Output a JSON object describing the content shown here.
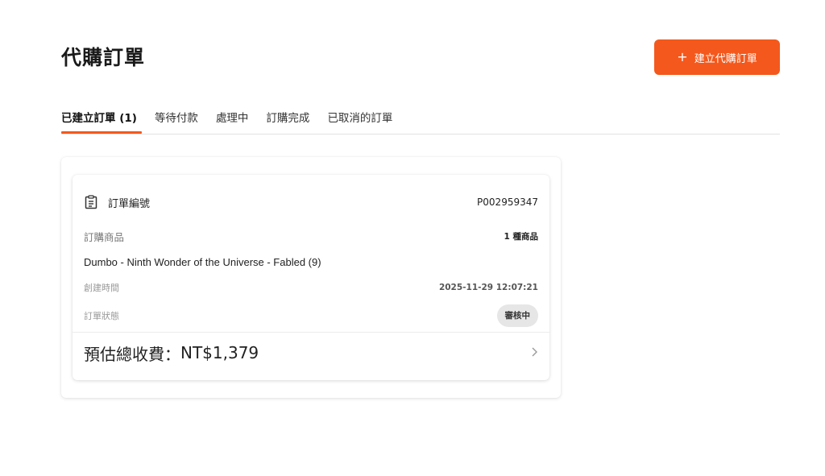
{
  "page": {
    "title": "代購訂單"
  },
  "header": {
    "create_button_label": "建立代購訂單",
    "create_button_icon": "plus-icon"
  },
  "tabs": [
    {
      "label": "已建立訂單 (1)",
      "active": true
    },
    {
      "label": "等待付款",
      "active": false
    },
    {
      "label": "處理中",
      "active": false
    },
    {
      "label": "訂購完成",
      "active": false
    },
    {
      "label": "已取消的訂單",
      "active": false
    }
  ],
  "order": {
    "number_label": "訂單編號",
    "number": "P002959347",
    "items_label": "訂購商品",
    "items_count": "1 種商品",
    "product_name": "Dumbo - Ninth Wonder of the Universe - Fabled (9)",
    "created_label": "創建時間",
    "created_at": "2025-11-29 12:07:21",
    "status_label": "訂單狀態",
    "status": "審核中",
    "total_label": "預估總收費：",
    "total_value": "NT$1,379"
  },
  "colors": {
    "accent": "#f4581c",
    "badge_bg": "#e6e6e6"
  },
  "icons": {
    "order_icon": "clipboard-icon",
    "detail_icon": "chevron-right-icon"
  }
}
